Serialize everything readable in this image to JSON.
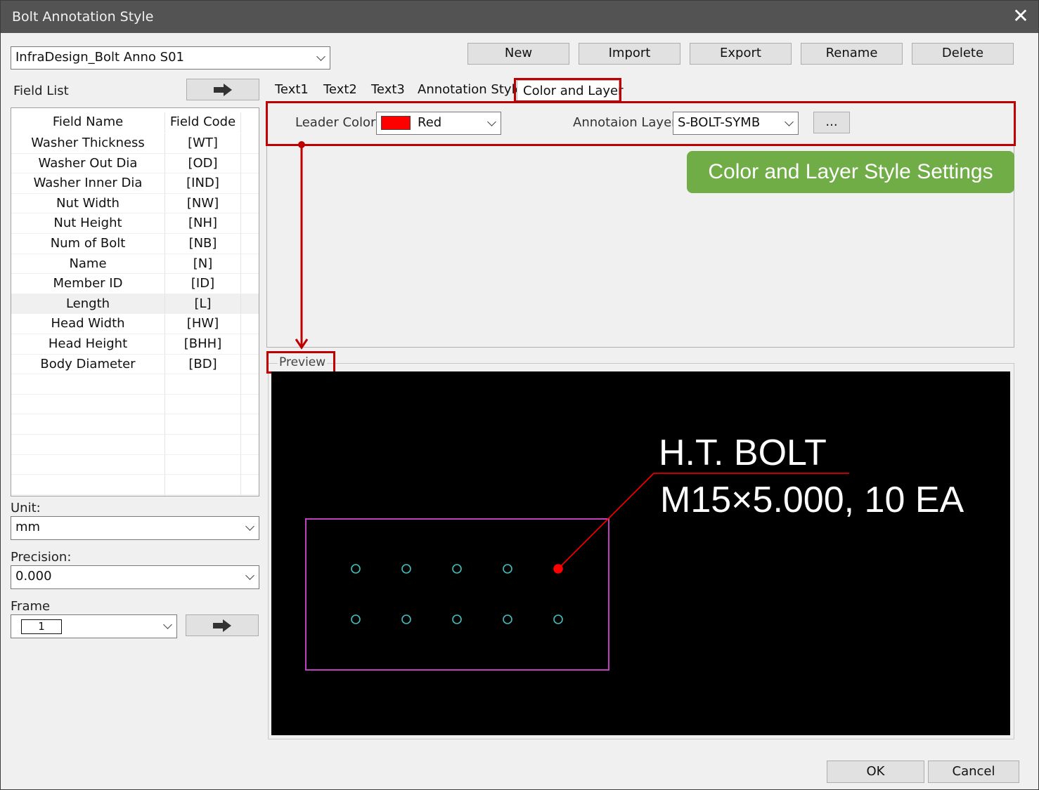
{
  "window": {
    "title": "Bolt Annotation Style"
  },
  "style_select": {
    "value": "InfraDesign_Bolt Anno S01"
  },
  "toolbar": {
    "new": "New",
    "import": "Import",
    "export": "Export",
    "rename": "Rename",
    "delete": "Delete"
  },
  "field_list": {
    "label": "Field List",
    "headers": {
      "name": "Field Name",
      "code": "Field Code"
    },
    "rows": [
      {
        "name": "Washer Thickness",
        "code": "[WT]"
      },
      {
        "name": "Washer Out Dia",
        "code": "[OD]"
      },
      {
        "name": "Washer Inner Dia",
        "code": "[IND]"
      },
      {
        "name": "Nut Width",
        "code": "[NW]"
      },
      {
        "name": "Nut Height",
        "code": "[NH]"
      },
      {
        "name": "Num of Bolt",
        "code": "[NB]"
      },
      {
        "name": "Name",
        "code": "[N]"
      },
      {
        "name": "Member ID",
        "code": "[ID]"
      },
      {
        "name": "Length",
        "code": "[L]"
      },
      {
        "name": "Head Width",
        "code": "[HW]"
      },
      {
        "name": "Head Height",
        "code": "[BHH]"
      },
      {
        "name": "Body Diameter",
        "code": "[BD]"
      }
    ]
  },
  "unit": {
    "label": "Unit:",
    "value": "mm"
  },
  "precision": {
    "label": "Precision:",
    "value": "0.000"
  },
  "frame": {
    "label": "Frame",
    "value": "1"
  },
  "tabs": [
    "Text1",
    "Text2",
    "Text3",
    "Annotation Style",
    "Color and Layer"
  ],
  "active_tab": "Color and Layer",
  "color_layer": {
    "leader_color_label": "Leader Color:",
    "leader_color_value": "Red",
    "leader_color_hex": "#ff0000",
    "layer_label": "Annotaion Layer:",
    "layer_value": "S-BOLT-SYMB",
    "more_button": "..."
  },
  "callout": "Color and Layer Style Settings",
  "preview": {
    "label": "Preview",
    "line1": "H.T. BOLT",
    "line2": "M15×5.000, 10 EA",
    "colors": {
      "frame": "#c040c0",
      "bolt": "#40c0c0",
      "leader": "#ff0000",
      "text": "#ffffff"
    }
  },
  "footer": {
    "ok": "OK",
    "cancel": "Cancel"
  }
}
